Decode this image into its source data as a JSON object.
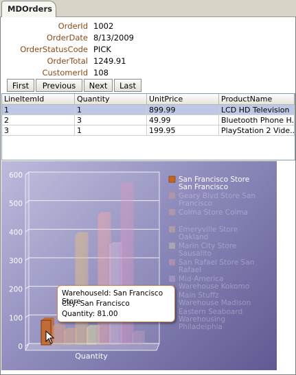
{
  "tab": {
    "label": "MDOrders"
  },
  "form": {
    "fields": [
      {
        "label": "OrderId",
        "value": "1002"
      },
      {
        "label": "OrderDate",
        "value": "8/13/2009"
      },
      {
        "label": "OrderStatusCode",
        "value": "PICK"
      },
      {
        "label": "OrderTotal",
        "value": "1249.91"
      },
      {
        "label": "CustomerId",
        "value": "108"
      }
    ]
  },
  "nav": {
    "first": "First",
    "previous": "Previous",
    "next": "Next",
    "last": "Last"
  },
  "grid": {
    "columns": [
      "LineItemId",
      "Quantity",
      "UnitPrice",
      "ProductName"
    ],
    "rows": [
      [
        "1",
        "1",
        "899.99",
        "LCD HD Television"
      ],
      [
        "2",
        "3",
        "49.99",
        "Bluetooth Phone H..."
      ],
      [
        "3",
        "1",
        "199.95",
        "PlayStation 2 Vide..."
      ]
    ],
    "selected_row": 0
  },
  "chart_data": {
    "type": "bar",
    "xlabel": "Quantity",
    "ylim": [
      0,
      600
    ],
    "yticks": [
      "0",
      "100",
      "200",
      "300",
      "400",
      "500",
      "600"
    ],
    "series": [
      {
        "name": "San Francisco Store San Francisco",
        "value": 81,
        "color": "#c8641e",
        "highlight": true
      },
      {
        "name": "Geary Blvd Store San Francisco",
        "value": 60,
        "color": "#e8a07a"
      },
      {
        "name": "Colma Store Colma",
        "value": 45,
        "color": "#e8b080"
      },
      {
        "name": "Emeryville Store Oakland",
        "value": 380,
        "color": "#e8c080"
      },
      {
        "name": "Marin City Store Sausalito",
        "value": 55,
        "color": "#e8e0a0"
      },
      {
        "name": "San Rafael Store San Rafael",
        "value": 450,
        "color": "#f0a8a8"
      },
      {
        "name": "Mid-America Warehouse Kokomo",
        "value": 345,
        "color": "#d8b8d8"
      },
      {
        "name": "Main Stuffz Warehouse Madison",
        "value": 555,
        "color": "#d898c0"
      },
      {
        "name": "Eastern Seaboard Warehousing Philadelphia",
        "value": 35,
        "color": "#c0a0c0"
      }
    ],
    "legend_position": "right",
    "grid": true
  },
  "tooltip": {
    "line1": "WarehouseId: San Francisco Store",
    "line2": "City: San Francisco",
    "line3": "Quantity: 81.00"
  }
}
